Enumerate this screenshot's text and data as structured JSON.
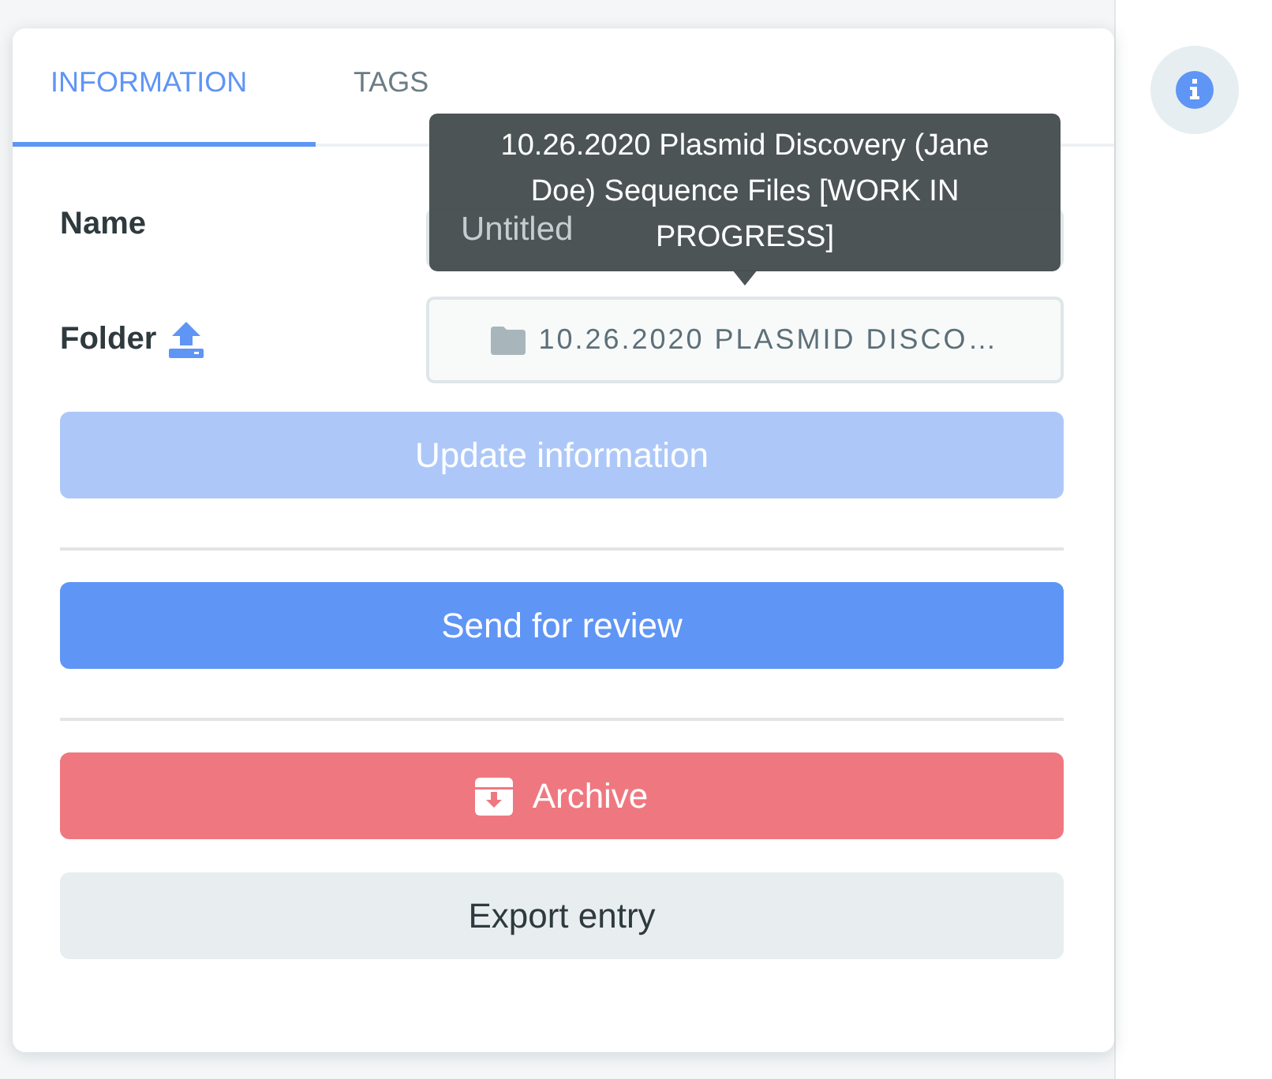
{
  "tabs": [
    {
      "label": "INFORMATION",
      "selected": true
    },
    {
      "label": "TAGS",
      "selected": false
    }
  ],
  "fields": [
    {
      "label": "Name",
      "kind": "text",
      "placeholder": "Untitled"
    },
    {
      "label": "Folder",
      "kind": "folder",
      "value": "10.26.2020 PLASMID DISCO…"
    }
  ],
  "tooltip": {
    "text": "10.26.2020 Plasmid Discovery (Jane Doe) Sequence Files [WORK IN PROGRESS]"
  },
  "actions": [
    {
      "label": "Update information",
      "kind": "primary",
      "disabled": true
    },
    {
      "label": "Send for review",
      "kind": "primary",
      "disabled": false
    },
    {
      "label": "Archive",
      "kind": "danger",
      "disabled": false
    },
    {
      "label": "Export entry",
      "kind": "secondary",
      "disabled": false
    }
  ]
}
